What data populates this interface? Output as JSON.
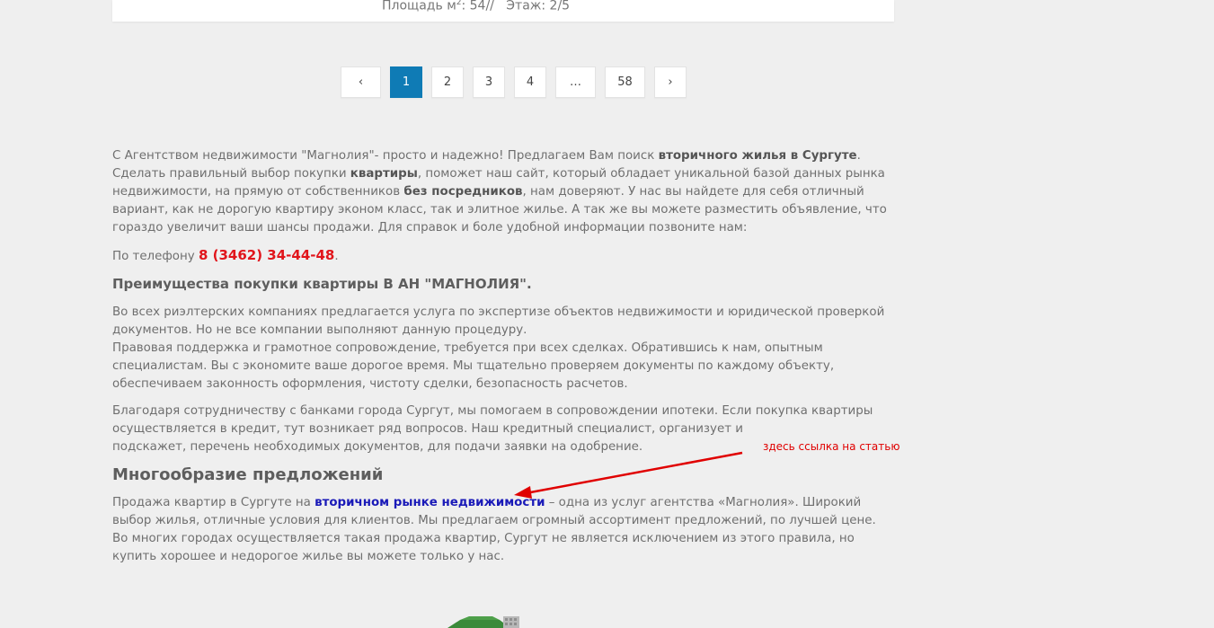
{
  "listing": {
    "area_label": "Площадь м",
    "area_sup": "2",
    "area_value": ": 54//",
    "floor": "Этаж: 2/5"
  },
  "pagination": {
    "prev": "‹",
    "pages": [
      "1",
      "2",
      "3",
      "4",
      "…",
      "58"
    ],
    "active": "1",
    "next": "›"
  },
  "intro": {
    "t1": "С Агентством недвижимости \"Магнолия\"- просто и надежно! Предлагаем Вам поиск ",
    "b1": "вторичного жилья в Сургуте",
    "t2": ". Сделать правильный выбор покупки ",
    "b2": "квартиры",
    "t3": ", поможет наш сайт, который обладает уникальной базой данных рынка недвижимости, на прямую от собственников ",
    "b3": "без посредников",
    "t4": ", нам доверяют. У нас вы найдете для себя отличный вариант, как не дорогую квартиру эконом класс, так и элитное жилье. А так же вы можете разместить объявление, что гораздо увеличит ваши шансы продажи. Для справок и боле удобной информации позвоните нам:"
  },
  "phone_line": {
    "label": "По телефону ",
    "number": "8 (3462) 34-44-48",
    "end": "."
  },
  "advantages": {
    "heading": "Преимущества покупки квартиры В АН \"МАГНОЛИЯ\".",
    "p1_line1": "Во всех риэлтерских компаниях предлагается услуга по экспертизе объектов недвижимости и юридической проверкой документов. Но не все компании выполняют данную процедуру.",
    "p1_line2": "Правовая поддержка и грамотное сопровождение, требуется при всех сделках. Обратившись к нам, опытным специалистам. Вы с экономите ваше дорогое время. Мы тщательно проверяем документы по каждому объекту, обеспечиваем законность оформления, чистоту сделки, безопасность расчетов.",
    "p2_line1": "Благодаря сотрудничеству с банками города Сургут, мы помогаем в сопровождении ипотеки. Если покупка квартиры осуществляется в кредит, тут возникает ряд вопросов. Наш кредитный специалист, организует и",
    "p2_line2": "подскажет, перечень необходимых документов, для подачи заявки на одобрение."
  },
  "variety": {
    "heading": "Многообразие предложений",
    "t1": "Продажа квартир в Сургуте на ",
    "link": "вторичном рынке недвижимости",
    "t2": " – одна из услуг агентства «Магнолия». Широкий выбор жилья, отличные условия для клиентов. Мы предлагаем огромный ассортимент предложений, по лучшей цене. Во многих городах осуществляется такая продажа квартир, Сургут не является исключением из этого правила, но купить хорошее и недорогое жилье вы можете только у нас."
  },
  "annotation": {
    "text": "здесь ссылка на статью",
    "color": "#e00000"
  },
  "colors": {
    "background": "#efefef",
    "active_page": "#0f7bb5",
    "phone": "#e1151b",
    "link": "#1a1ab8"
  }
}
